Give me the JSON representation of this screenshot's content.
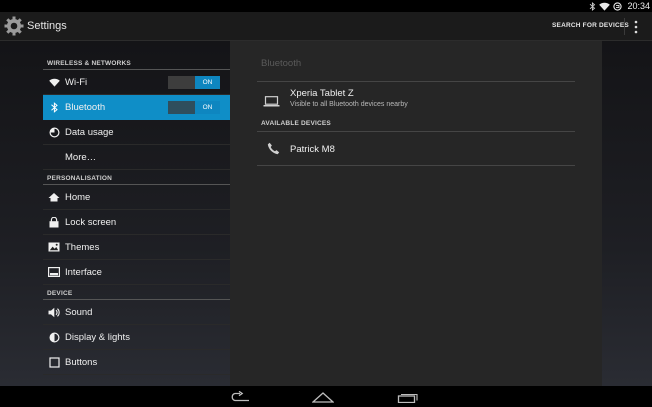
{
  "status_bar": {
    "time": "20:34",
    "icons": [
      "bluetooth-icon",
      "wifi-icon",
      "sync-icon"
    ]
  },
  "action_bar": {
    "title": "Settings",
    "app_icon": "settings-gear-icon",
    "action_label": "SEARCH FOR DEVICES",
    "overflow_icon": "overflow-menu-icon"
  },
  "sidebar": {
    "categories": {
      "wireless": "WIRELESS & NETWORKS",
      "personalisation": "PERSONALISATION",
      "device": "DEVICE"
    },
    "items": {
      "wifi": {
        "label": "Wi-Fi",
        "icon": "wifi-icon",
        "toggle": "ON"
      },
      "bluetooth": {
        "label": "Bluetooth",
        "icon": "bluetooth-icon",
        "toggle": "ON",
        "selected": true
      },
      "data_usage": {
        "label": "Data usage",
        "icon": "data-usage-icon"
      },
      "more": {
        "label": "More…"
      },
      "home": {
        "label": "Home",
        "icon": "home-icon"
      },
      "lock_screen": {
        "label": "Lock screen",
        "icon": "lock-icon"
      },
      "themes": {
        "label": "Themes",
        "icon": "themes-icon"
      },
      "interface": {
        "label": "Interface",
        "icon": "interface-icon"
      },
      "sound": {
        "label": "Sound",
        "icon": "sound-icon"
      },
      "display": {
        "label": "Display & lights",
        "icon": "display-icon"
      },
      "buttons": {
        "label": "Buttons",
        "icon": "buttons-icon"
      }
    }
  },
  "details": {
    "title": "Bluetooth",
    "this_device": {
      "name": "Xperia Tablet Z",
      "subtitle": "Visible to all Bluetooth devices nearby",
      "icon": "laptop-icon"
    },
    "available_header": "AVAILABLE DEVICES",
    "available_devices": [
      {
        "name": "Patrick M8",
        "icon": "phone-icon"
      }
    ]
  },
  "nav_bar": {
    "buttons": [
      "back-icon",
      "home-nav-icon",
      "recents-icon"
    ]
  },
  "colors": {
    "accent": "#0f8ec7",
    "background": "#1b1b1b",
    "pane": "#262626"
  }
}
